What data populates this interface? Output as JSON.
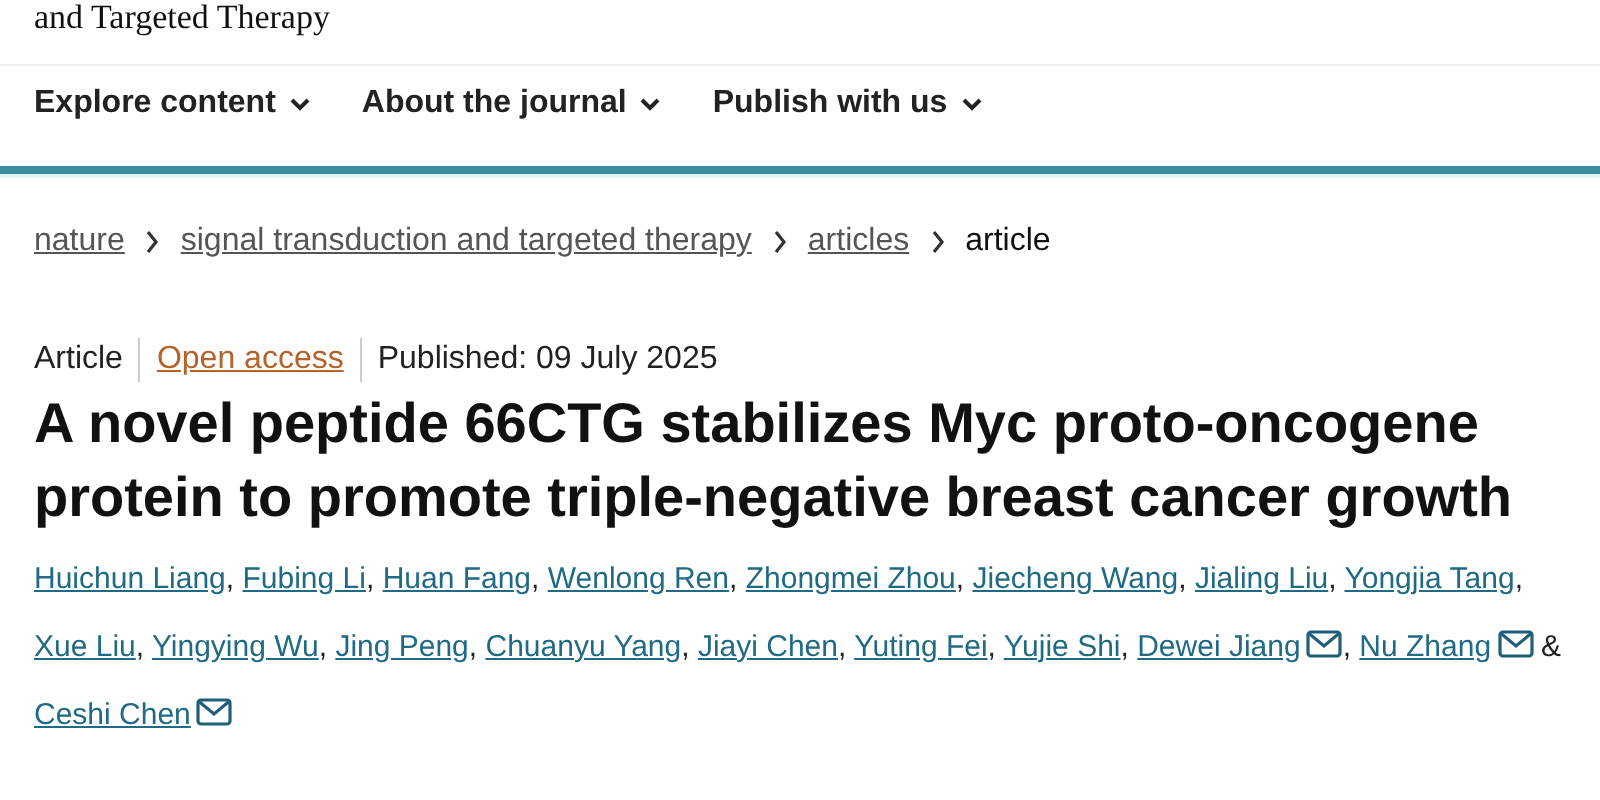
{
  "journal_title": "and Targeted Therapy",
  "nav": [
    {
      "label": "Explore content",
      "dropdown": true
    },
    {
      "label": "About the journal",
      "dropdown": true
    },
    {
      "label": "Publish with us",
      "dropdown": true
    }
  ],
  "breadcrumb": [
    {
      "label": "nature",
      "link": true
    },
    {
      "label": "signal transduction and targeted therapy",
      "link": true
    },
    {
      "label": "articles",
      "link": true
    },
    {
      "label": "article",
      "link": false
    }
  ],
  "article_type": "Article",
  "access": "Open access",
  "published": "Published: 09 July 2025",
  "title": "A novel peptide 66CTG stabilizes Myc proto-oncogene protein to promote triple-negative breast cancer growth",
  "authors": [
    {
      "name": "Huichun Liang",
      "email": false,
      "separator": ","
    },
    {
      "name": "Fubing Li",
      "email": false,
      "separator": ","
    },
    {
      "name": "Huan Fang",
      "email": false,
      "separator": ","
    },
    {
      "name": "Wenlong Ren",
      "email": false,
      "separator": ","
    },
    {
      "name": "Zhongmei Zhou",
      "email": false,
      "separator": ","
    },
    {
      "name": "Jiecheng Wang",
      "email": false,
      "separator": ","
    },
    {
      "name": "Jialing Liu",
      "email": false,
      "separator": ","
    },
    {
      "name": "Yongjia Tang",
      "email": false,
      "separator": ","
    },
    {
      "name": "Xue Liu",
      "email": false,
      "separator": ","
    },
    {
      "name": "Yingying Wu",
      "email": false,
      "separator": ","
    },
    {
      "name": "Jing Peng",
      "email": false,
      "separator": ","
    },
    {
      "name": "Chuanyu Yang",
      "email": false,
      "separator": ","
    },
    {
      "name": "Jiayi Chen",
      "email": false,
      "separator": ","
    },
    {
      "name": "Yuting Fei",
      "email": false,
      "separator": ","
    },
    {
      "name": "Yujie Shi",
      "email": false,
      "separator": ","
    },
    {
      "name": "Dewei Jiang",
      "email": true,
      "separator": ","
    },
    {
      "name": "Nu Zhang",
      "email": true,
      "separator": "&"
    },
    {
      "name": "Ceshi Chen",
      "email": true
    }
  ]
}
